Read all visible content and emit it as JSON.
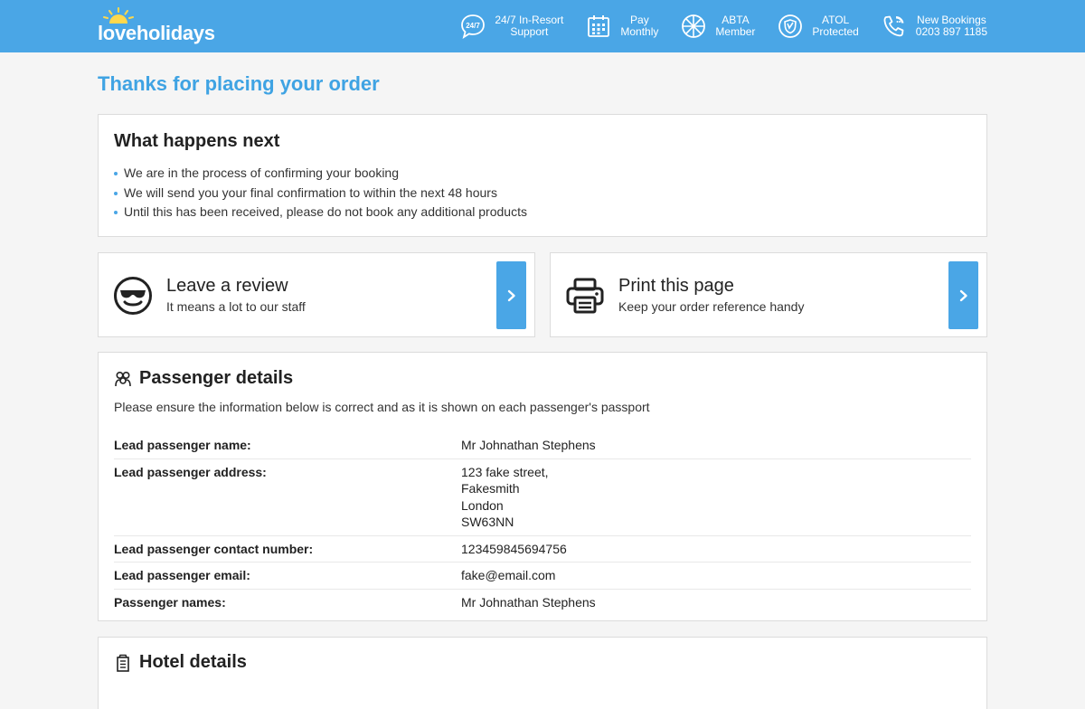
{
  "header": {
    "logo_text": "loveholidays",
    "nav": [
      {
        "icon": "chat-24-7-icon",
        "line1": "24/7 In-Resort",
        "line2": "Support"
      },
      {
        "icon": "calendar-icon",
        "line1": "Pay",
        "line2": "Monthly"
      },
      {
        "icon": "abta-globe-icon",
        "line1": "ABTA",
        "line2": "Member"
      },
      {
        "icon": "atol-shield-icon",
        "line1": "ATOL",
        "line2": "Protected"
      },
      {
        "icon": "phone-icon",
        "line1": "New Bookings",
        "line2": "0203 897 1185"
      }
    ]
  },
  "page_title": "Thanks for placing your order",
  "next": {
    "title": "What happens next",
    "items": [
      "We are in the process of confirming your booking",
      "We will send you your final confirmation to within the next 48 hours",
      "Until this has been received, please do not book any additional products"
    ]
  },
  "actions": [
    {
      "icon": "sunglasses-smiley-icon",
      "title": "Leave a review",
      "subtitle": "It means a lot to our staff"
    },
    {
      "icon": "printer-icon",
      "title": "Print this page",
      "subtitle": "Keep your order reference handy"
    }
  ],
  "passenger": {
    "title": "Passenger details",
    "intro": "Please ensure the information below is correct and as it is shown on each passenger's passport",
    "rows": [
      {
        "label": "Lead passenger name:",
        "value": [
          "Mr Johnathan Stephens"
        ]
      },
      {
        "label": "Lead passenger address:",
        "value": [
          "123 fake street,",
          "Fakesmith",
          "London",
          "SW63NN"
        ]
      },
      {
        "label": "Lead passenger contact number:",
        "value": [
          "123459845694756"
        ]
      },
      {
        "label": "Lead passenger email:",
        "value": [
          "fake@email.com"
        ]
      },
      {
        "label": "Passenger names:",
        "value": [
          "Mr Johnathan Stephens"
        ]
      }
    ]
  },
  "hotel": {
    "title": "Hotel details"
  },
  "colors": {
    "brand_blue": "#4aa6e6",
    "title_blue": "#3fa3e3"
  }
}
